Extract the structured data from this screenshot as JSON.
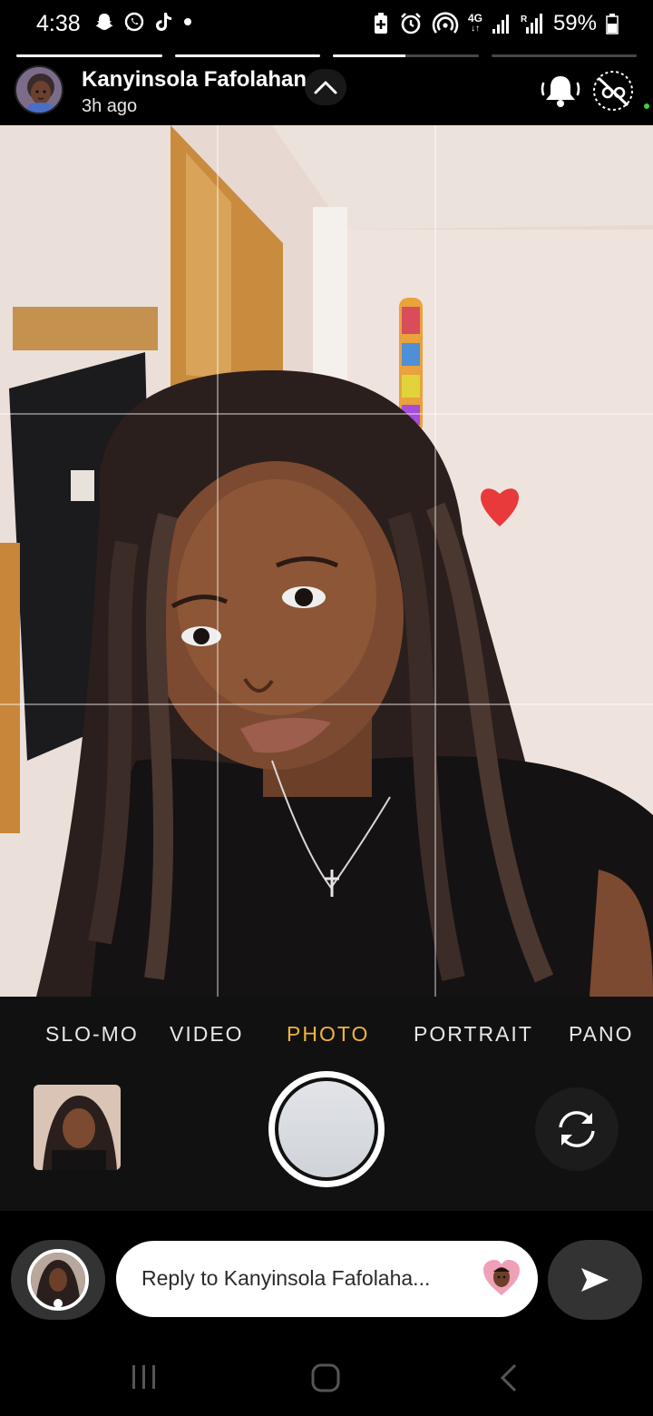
{
  "status_bar": {
    "time": "4:38",
    "battery_percent": "59%",
    "network_label": "4G",
    "left_icons": [
      "snapchat-icon",
      "whatsapp-icon",
      "tiktok-icon",
      "notification-dot"
    ],
    "right_icons": [
      "battery-saver-icon",
      "alarm-icon",
      "hotspot-icon",
      "network-4g-icon",
      "signal-icon",
      "signal-roaming-icon",
      "battery-icon"
    ]
  },
  "story": {
    "progress_segments": [
      1,
      1,
      0.5,
      0
    ],
    "username": "Kanyinsola Fafolahan",
    "time_ago": "3h ago",
    "icons": {
      "expand": "chevron-up-icon",
      "notify": "bell-icon",
      "mute": "mute-icon"
    }
  },
  "camera": {
    "modes": [
      "SLO-MO",
      "VIDEO",
      "PHOTO",
      "PORTRAIT",
      "PANO"
    ],
    "active_mode": "PHOTO",
    "accent_color": "#f0b43c",
    "icons": {
      "flip": "flip-camera-icon",
      "shutter": "shutter-button"
    }
  },
  "reply": {
    "placeholder": "Reply to Kanyinsola Fafolaha...",
    "icons": {
      "camera": "camera-icon",
      "emoji": "heart-bitmoji-icon",
      "send": "send-arrow-icon"
    }
  },
  "nav": {
    "icons": [
      "recent-apps-icon",
      "home-icon",
      "back-icon"
    ]
  }
}
